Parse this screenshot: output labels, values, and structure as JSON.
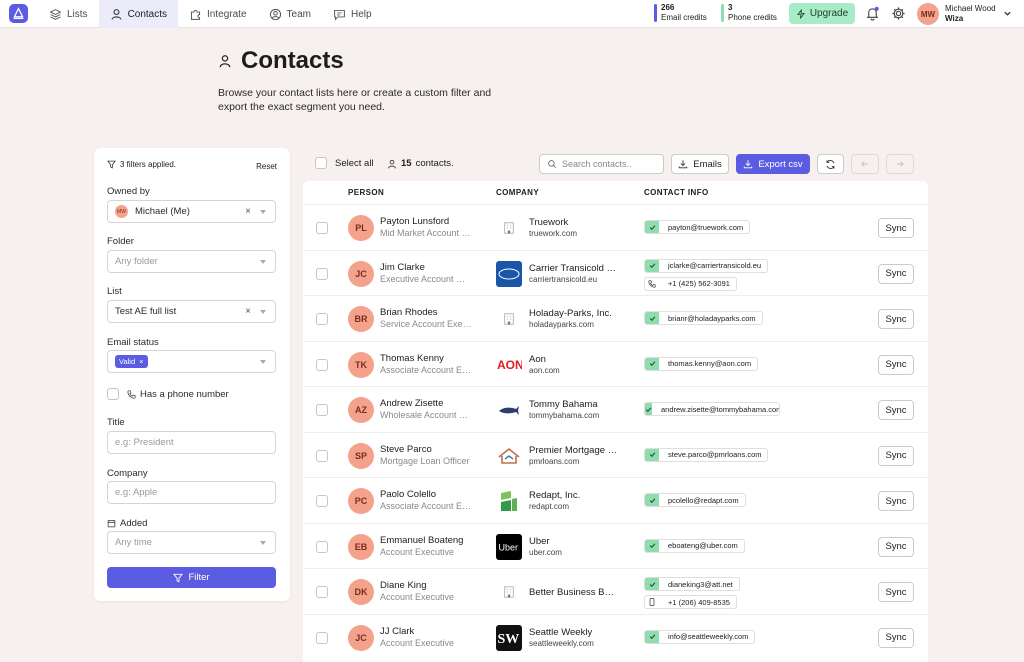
{
  "nav": {
    "items": [
      {
        "label": "Lists",
        "icon": "lists-icon"
      },
      {
        "label": "Contacts",
        "icon": "user-icon",
        "active": true
      },
      {
        "label": "Integrate",
        "icon": "puzzle-icon"
      },
      {
        "label": "Team",
        "icon": "team-icon"
      },
      {
        "label": "Help",
        "icon": "chat-icon"
      }
    ]
  },
  "credits": {
    "email": {
      "count": "266",
      "label": "Email credits",
      "color": "#5b5ce2"
    },
    "phone": {
      "count": "3",
      "label": "Phone credits",
      "color": "#8fdcae"
    }
  },
  "upgrade_label": "Upgrade",
  "user": {
    "initials": "MW",
    "name": "Michael Wood",
    "org": "Wiza"
  },
  "page": {
    "title": "Contacts",
    "subtitle": "Browse your contact lists here or create a custom filter and export the exact segment you need."
  },
  "filters": {
    "summary": "3 filters applied.",
    "reset": "Reset",
    "owned_by": {
      "label": "Owned by",
      "value": "Michael (Me)",
      "avatar": "MW"
    },
    "folder": {
      "label": "Folder",
      "placeholder": "Any folder"
    },
    "list": {
      "label": "List",
      "value": "Test AE full list"
    },
    "email_status": {
      "label": "Email status",
      "tag": "Valid"
    },
    "phone": {
      "label": "Has a phone number"
    },
    "title": {
      "label": "Title",
      "placeholder": "e.g: President"
    },
    "company": {
      "label": "Company",
      "placeholder": "e.g: Apple"
    },
    "added": {
      "label": "Added",
      "placeholder": "Any time"
    },
    "button": "Filter"
  },
  "toolbar": {
    "select_all": "Select all",
    "count": "15",
    "count_suffix": "contacts.",
    "search_placeholder": "Search contacts..",
    "emails": "Emails",
    "export": "Export csv"
  },
  "table": {
    "headers": [
      "PERSON",
      "COMPANY",
      "CONTACT INFO"
    ],
    "sync_label": "Sync",
    "rows": [
      {
        "initials": "PL",
        "name": "Payton Lunsford",
        "title": "Mid Market Account Executive",
        "company": "Truework",
        "domain": "truework.com",
        "logo": "building",
        "email": "payton@truework.com"
      },
      {
        "initials": "JC",
        "name": "Jim Clarke",
        "title": "Executive Account Manager",
        "company": "Carrier Transicold Thermo",
        "domain": "carriertransicold.eu",
        "logo": "carrier",
        "email": "jclarke@carriertransicold.eu",
        "phone": "+1 (425) 562-3091",
        "phone_icon": "phone-icon"
      },
      {
        "initials": "BR",
        "name": "Brian Rhodes",
        "title": "Service Account Executive",
        "company": "Holaday-Parks, Inc.",
        "domain": "holadayparks.com",
        "logo": "building",
        "email": "brianr@holadayparks.com"
      },
      {
        "initials": "TK",
        "name": "Thomas Kenny",
        "title": "Associate Account Executive",
        "company": "Aon",
        "domain": "aon.com",
        "logo": "aon",
        "email": "thomas.kenny@aon.com"
      },
      {
        "initials": "AZ",
        "name": "Andrew Zisette",
        "title": "Wholesale Account Executive",
        "company": "Tommy Bahama",
        "domain": "tommybahama.com",
        "logo": "marlin",
        "email": "andrew.zisette@tommybahama.com"
      },
      {
        "initials": "SP",
        "name": "Steve Parco",
        "title": "Mortgage Loan Officer",
        "company": "Premier Mortgage Resources",
        "domain": "pmrloans.com",
        "logo": "house",
        "email": "steve.parco@pmrloans.com"
      },
      {
        "initials": "PC",
        "name": "Paolo Colello",
        "title": "Associate Account Executive",
        "company": "Redapt, Inc.",
        "domain": "redapt.com",
        "logo": "redapt",
        "email": "pcolello@redapt.com"
      },
      {
        "initials": "EB",
        "name": "Emmanuel Boateng",
        "title": "Account Executive",
        "company": "Uber",
        "domain": "uber.com",
        "logo": "uber",
        "email": "eboateng@uber.com"
      },
      {
        "initials": "DK",
        "name": "Diane King",
        "title": "Account Executive",
        "company": "Better Business Bureau",
        "domain": "",
        "logo": "building",
        "email": "dianeking3@att.net",
        "phone": "+1 (206) 409-8535",
        "phone_icon": "mobile-icon"
      },
      {
        "initials": "JC",
        "name": "JJ Clark",
        "title": "Account Executive",
        "company": "Seattle Weekly",
        "domain": "seattleweekly.com",
        "logo": "sw",
        "email": "info@seattleweekly.com"
      }
    ]
  }
}
